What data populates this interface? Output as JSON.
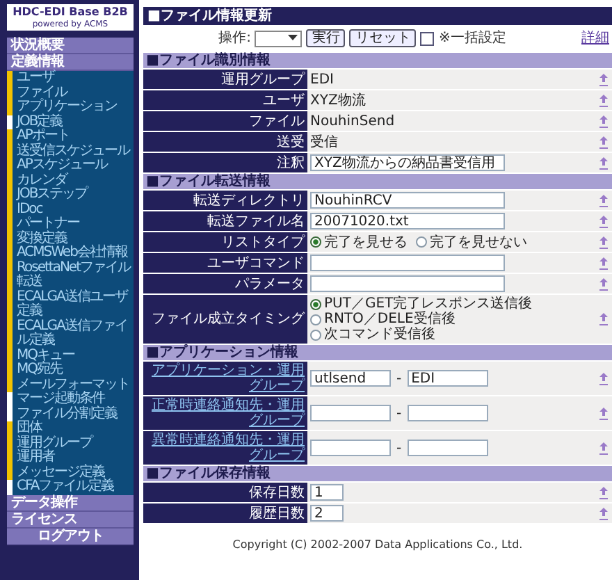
{
  "sidebar": {
    "logo": {
      "title": "HDC-EDI Base B2B",
      "subtitle": "powered by ACMS"
    },
    "items": [
      {
        "kind": "header",
        "label": "状況概要"
      },
      {
        "kind": "header",
        "label": "定義情報"
      },
      {
        "kind": "item",
        "label": "ユーザ",
        "color": "#f2c200"
      },
      {
        "kind": "item",
        "label": "ファイル",
        "color": "#f2c200"
      },
      {
        "kind": "item",
        "label": "アプリケーション",
        "color": "#f2c200"
      },
      {
        "kind": "item",
        "label": "JOB定義",
        "color": "#ffffff"
      },
      {
        "kind": "item",
        "label": "APポート",
        "color": "#f2c200"
      },
      {
        "kind": "item",
        "label": "送受信スケジュール",
        "color": "#f2c200"
      },
      {
        "kind": "item",
        "label": "APスケジュール",
        "color": "#f2c200"
      },
      {
        "kind": "item",
        "label": "カレンダ",
        "color": "#f2c200"
      },
      {
        "kind": "item",
        "label": "JOBステップ",
        "color": "#f2c200"
      },
      {
        "kind": "item",
        "label": "IDoc",
        "color": "#f2c200"
      },
      {
        "kind": "item",
        "label": "パートナー",
        "color": "#f2c200"
      },
      {
        "kind": "item",
        "label": "変換定義",
        "color": "#f2c200"
      },
      {
        "kind": "item",
        "label": "ACMSWeb会社情報",
        "color": "#f2c200"
      },
      {
        "kind": "item",
        "label": "RosettaNetファイル転送",
        "color": "#f2c200"
      },
      {
        "kind": "item",
        "label": "ECALGA送信ユーザ定義",
        "color": "#f2c200"
      },
      {
        "kind": "item",
        "label": "ECALGA送信ファイル定義",
        "color": "#f2c200"
      },
      {
        "kind": "item",
        "label": "MQキュー",
        "color": "#f2c200"
      },
      {
        "kind": "item",
        "label": "MQ宛先",
        "color": "#f2c200"
      },
      {
        "kind": "item",
        "label": "メールフォーマット",
        "color": "#f2c200"
      },
      {
        "kind": "item",
        "label": "マージ起動条件",
        "color": "#ffffff"
      },
      {
        "kind": "item",
        "label": "ファイル分割定義",
        "color": "#ffffff"
      },
      {
        "kind": "item",
        "label": "団体",
        "color": "#f2c200"
      },
      {
        "kind": "item",
        "label": "運用グループ",
        "color": "#f2c200"
      },
      {
        "kind": "item",
        "label": "運用者",
        "color": "#f2c200"
      },
      {
        "kind": "item",
        "label": "メッセージ定義",
        "color": "#f2c200"
      },
      {
        "kind": "item",
        "label": "CFAファイル定義",
        "color": "#ffffff"
      },
      {
        "kind": "header",
        "label": "データ操作"
      },
      {
        "kind": "header",
        "label": "ライセンス"
      },
      {
        "kind": "logout",
        "label": "ログアウト"
      }
    ]
  },
  "page_title": "■ファイル情報更新",
  "toolbar": {
    "operation_label": "操作:",
    "buttons": [
      "実行",
      "リセット"
    ],
    "bulk_checkbox": {
      "label": "※一括設定",
      "checked": false
    },
    "detail_link": "詳細"
  },
  "sections": [
    {
      "title": "■ファイル識別情報",
      "rows": [
        {
          "kind": "text",
          "label": "運用グループ",
          "link": false,
          "value": "EDI"
        },
        {
          "kind": "text",
          "label": "ユーザ",
          "link": false,
          "value": "XYZ物流"
        },
        {
          "kind": "text",
          "label": "ファイル",
          "link": false,
          "value": "NouhinSend"
        },
        {
          "kind": "text",
          "label": "送受",
          "link": false,
          "value": "受信"
        },
        {
          "kind": "input",
          "label": "注釈",
          "link": false,
          "value": "XYZ物流からの納品書受信用"
        }
      ]
    },
    {
      "title": "■ファイル転送情報",
      "rows": [
        {
          "kind": "input",
          "label": "転送ディレクトリ",
          "link": false,
          "value": "NouhinRCV"
        },
        {
          "kind": "input",
          "label": "転送ファイル名",
          "link": false,
          "value": "20071020.txt"
        },
        {
          "kind": "radio_row",
          "label": "リストタイプ",
          "link": false,
          "options": [
            {
              "label": "完了を見せる",
              "selected": true
            },
            {
              "label": "完了を見せない",
              "selected": false
            }
          ]
        },
        {
          "kind": "input",
          "label": "ユーザコマンド",
          "link": false
        },
        {
          "kind": "input",
          "label": "パラメータ",
          "link": false
        },
        {
          "kind": "radio_list",
          "label": "ファイル成立タイミング",
          "link": false,
          "options": [
            {
              "label": "PUT／GET完了レスポンス送信後",
              "selected": true
            },
            {
              "label": "RNTO／DELE受信後",
              "selected": false
            },
            {
              "label": "次コマンド受信後",
              "selected": false
            }
          ]
        }
      ]
    },
    {
      "title": "■アプリケーション情報",
      "rows": [
        {
          "kind": "pair",
          "label": "アプリケーション・運用グループ",
          "link": true,
          "values": [
            "utlsend",
            "EDI"
          ],
          "separator": "-"
        },
        {
          "kind": "pair",
          "label": "正常時連絡通知先・運用グループ",
          "link": true,
          "separator": "-"
        },
        {
          "kind": "pair",
          "label": "異常時連絡通知先・運用グループ",
          "link": true,
          "separator": "-"
        }
      ]
    },
    {
      "title": "■ファイル保存情報",
      "rows": [
        {
          "kind": "short_input",
          "label": "保存日数",
          "link": false,
          "value": "1"
        },
        {
          "kind": "short_input",
          "label": "履歴日数",
          "link": false,
          "value": "2"
        }
      ]
    }
  ],
  "copyright": "Copyright (C) 2002-2007 Data Applications Co., Ltd."
}
